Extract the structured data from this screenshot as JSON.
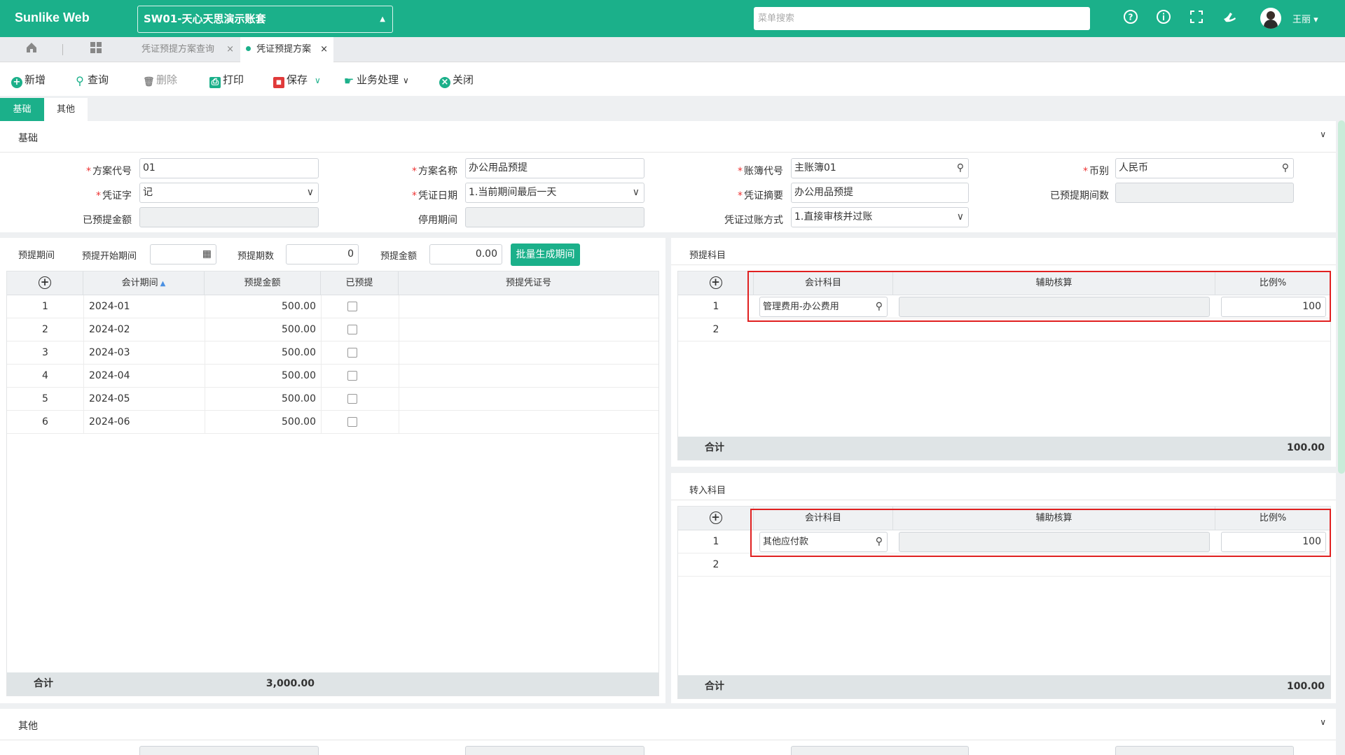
{
  "app": {
    "title": "Sunlike Web",
    "account": "SW01-天心天思演示账套",
    "search_placeholder": "菜单搜索",
    "user": "王丽 ▾"
  },
  "tabs": [
    {
      "label": "凭证预提方案查询"
    },
    {
      "label": "凭证预提方案"
    }
  ],
  "toolbar": {
    "new": "新增",
    "query": "查询",
    "delete": "删除",
    "print": "打印",
    "save": "保存",
    "business": "业务处理",
    "close": "关闭"
  },
  "subtabs": {
    "basic": "基础",
    "other": "其他"
  },
  "basic": {
    "section_title": "基础",
    "plan_code": {
      "label": "方案代号",
      "value": "01"
    },
    "plan_name": {
      "label": "方案名称",
      "value": "办公用品预提"
    },
    "ledger_code": {
      "label": "账簿代号",
      "value": "主账簿01"
    },
    "currency": {
      "label": "币别",
      "value": "人民币"
    },
    "voucher_word": {
      "label": "凭证字",
      "value": "记"
    },
    "voucher_date": {
      "label": "凭证日期",
      "value": "1.当前期间最后一天"
    },
    "voucher_summary": {
      "label": "凭证摘要",
      "value": "办公用品预提"
    },
    "accrued_periods": {
      "label": "已预提期间数",
      "value": ""
    },
    "accrued_amount": {
      "label": "已预提金额",
      "value": ""
    },
    "stop_period": {
      "label": "停用期间",
      "value": ""
    },
    "posting_mode": {
      "label": "凭证过账方式",
      "value": "1.直接审核并过账"
    }
  },
  "period_panel": {
    "title": "预提期间",
    "start_label": "预提开始期间",
    "start_value": "",
    "count_label": "预提期数",
    "count_value": "0",
    "amount_label": "预提金额",
    "amount_value": "0.00",
    "batch_button": "批量生成期间",
    "columns": [
      "会计期间",
      "预提金额",
      "已预提",
      "预提凭证号"
    ],
    "rows": [
      {
        "no": "1",
        "period": "2024-01",
        "amount": "500.00"
      },
      {
        "no": "2",
        "period": "2024-02",
        "amount": "500.00"
      },
      {
        "no": "3",
        "period": "2024-03",
        "amount": "500.00"
      },
      {
        "no": "4",
        "period": "2024-04",
        "amount": "500.00"
      },
      {
        "no": "5",
        "period": "2024-05",
        "amount": "500.00"
      },
      {
        "no": "6",
        "period": "2024-06",
        "amount": "500.00"
      }
    ],
    "total_label": "合计",
    "total_amount": "3,000.00"
  },
  "accrual_subject": {
    "title": "预提科目",
    "columns": [
      "会计科目",
      "辅助核算",
      "比例%"
    ],
    "rows": [
      {
        "no": "1",
        "subject": "管理费用-办公费用",
        "ratio": "100"
      },
      {
        "no": "2"
      }
    ],
    "total_label": "合计",
    "total": "100.00"
  },
  "transfer_subject": {
    "title": "转入科目",
    "columns": [
      "会计科目",
      "辅助核算",
      "比例%"
    ],
    "rows": [
      {
        "no": "1",
        "subject": "其他应付款",
        "ratio": "100"
      },
      {
        "no": "2"
      }
    ],
    "total_label": "合计",
    "total": "100.00"
  },
  "other_section": {
    "title": "其他"
  }
}
